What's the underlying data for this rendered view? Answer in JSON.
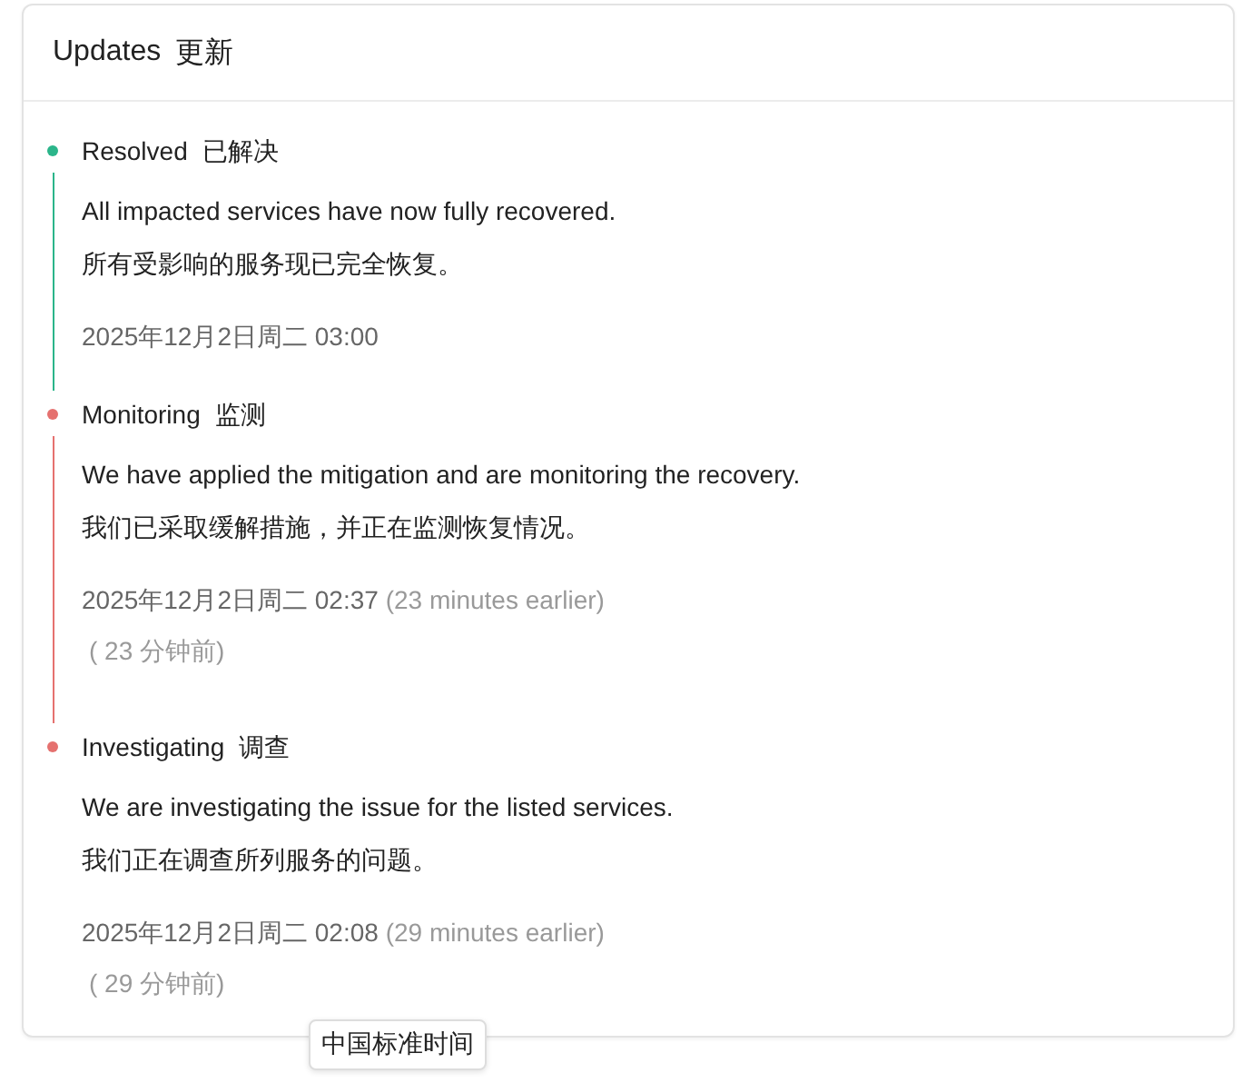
{
  "card": {
    "title": "Updates",
    "title_zh": "更新"
  },
  "updates": [
    {
      "status": "Resolved",
      "status_zh": "已解决",
      "color": "#2bb58a",
      "body": "All impacted services have now fully recovered.",
      "body_zh": "所有受影响的服务现已完全恢复。",
      "time": "2025年12月2日周二 03:00"
    },
    {
      "status": "Monitoring",
      "status_zh": "监测",
      "color": "#e5716f",
      "body": "We have applied the mitigation and are monitoring the recovery.",
      "body_zh": "我们已采取缓解措施，并正在监测恢复情况。",
      "time": "2025年12月2日周二 02:37",
      "relative": "(23 minutes earlier)",
      "relative_zh": "( 23 分钟前)"
    },
    {
      "status": "Investigating",
      "status_zh": "调查",
      "color": "#e5716f",
      "body": "We are investigating the issue for the listed services.",
      "body_zh": "我们正在调查所列服务的问题。",
      "time": "2025年12月2日周二 02:08",
      "relative": "(29 minutes earlier)",
      "relative_zh": "( 29 分钟前)"
    }
  ],
  "tooltip": "中国标准时间"
}
